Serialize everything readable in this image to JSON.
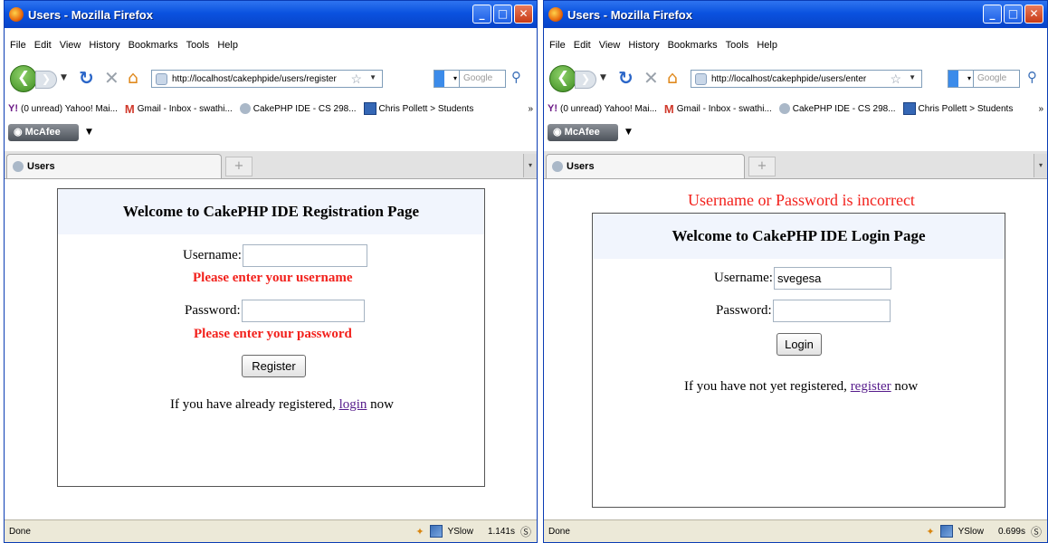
{
  "left": {
    "title": "Users - Mozilla Firefox",
    "window_controls": {
      "minimize": "_",
      "maximize": "□",
      "close": "✕"
    },
    "menu": [
      "File",
      "Edit",
      "View",
      "History",
      "Bookmarks",
      "Tools",
      "Help"
    ],
    "url": "http://localhost/cakephpide/users/register",
    "search_placeholder": "Google",
    "bookmarks": [
      {
        "icon": "yahoo-icon",
        "label": "(0 unread) Yahoo! Mai..."
      },
      {
        "icon": "gmail-icon",
        "label": "Gmail - Inbox - swathi..."
      },
      {
        "icon": "cakephp-icon",
        "label": "CakePHP IDE - CS 298..."
      },
      {
        "icon": "page-icon",
        "label": "Chris Pollett > Students"
      }
    ],
    "bookmarks_more": "»",
    "mcafee_label": "McAfee",
    "tab_label": "Users",
    "page": {
      "heading": "Welcome to CakePHP IDE Registration Page",
      "username_label": "Username:",
      "username_value": "",
      "username_error": "Please enter your username",
      "password_label": "Password:",
      "password_value": "",
      "password_error": "Please enter your password",
      "submit_label": "Register",
      "note_before": "If you have already registered, ",
      "note_link": "login",
      "note_after": " now"
    },
    "status": {
      "text": "Done",
      "yslow": "YSlow",
      "time": "1.141s"
    }
  },
  "right": {
    "title": "Users - Mozilla Firefox",
    "window_controls": {
      "minimize": "_",
      "maximize": "□",
      "close": "✕"
    },
    "menu": [
      "File",
      "Edit",
      "View",
      "History",
      "Bookmarks",
      "Tools",
      "Help"
    ],
    "url": "http://localhost/cakephpide/users/enter",
    "search_placeholder": "Google",
    "bookmarks": [
      {
        "icon": "yahoo-icon",
        "label": "(0 unread) Yahoo! Mai..."
      },
      {
        "icon": "gmail-icon",
        "label": "Gmail - Inbox - swathi..."
      },
      {
        "icon": "cakephp-icon",
        "label": "CakePHP IDE - CS 298..."
      },
      {
        "icon": "page-icon",
        "label": "Chris Pollett > Students"
      }
    ],
    "bookmarks_more": "»",
    "mcafee_label": "McAfee",
    "tab_label": "Users",
    "page": {
      "banner": "Username or Password is incorrect",
      "heading": "Welcome to CakePHP IDE Login Page",
      "username_label": "Username:",
      "username_value": "svegesa",
      "password_label": "Password:",
      "password_value": "",
      "submit_label": "Login",
      "note_before": "If you have not yet registered, ",
      "note_link": "register",
      "note_after": " now"
    },
    "status": {
      "text": "Done",
      "yslow": "YSlow",
      "time": "0.699s"
    }
  }
}
